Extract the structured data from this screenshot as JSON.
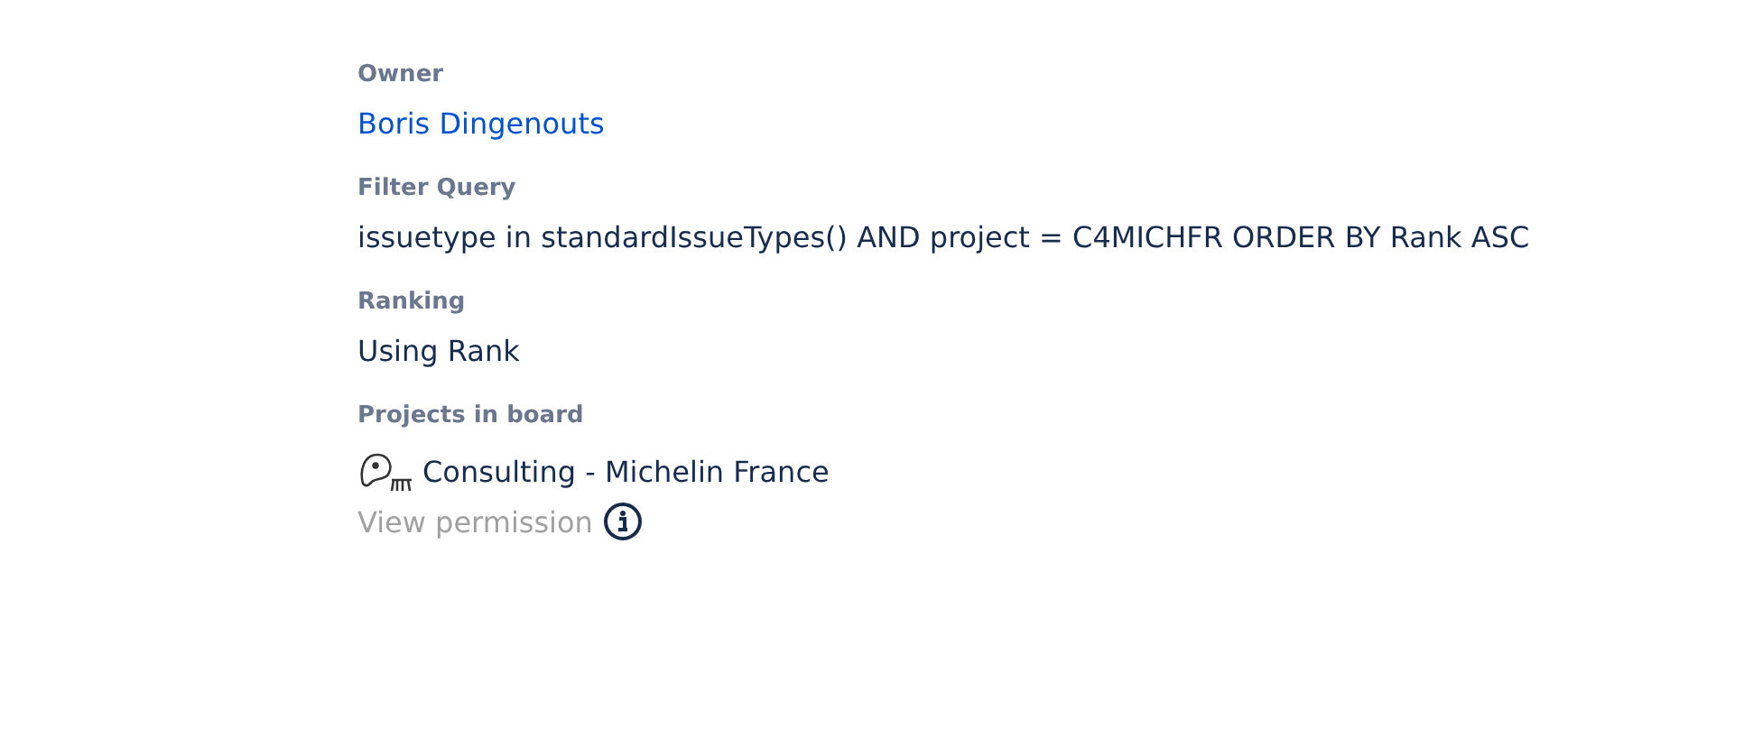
{
  "fields": [
    {
      "kind": "link",
      "label": "Owner",
      "value": "Boris Dingenouts"
    },
    {
      "kind": "text",
      "label": "Filter Query",
      "value": "issuetype in standardIssueTypes() AND project = C4MICHFR ORDER BY Rank ASC"
    },
    {
      "kind": "text",
      "label": "Ranking",
      "value": "Using Rank"
    },
    {
      "kind": "projects",
      "label": "Projects in board",
      "projects": [
        {
          "name": "Consulting - Michelin France"
        }
      ],
      "permission_link": "View permission"
    }
  ]
}
